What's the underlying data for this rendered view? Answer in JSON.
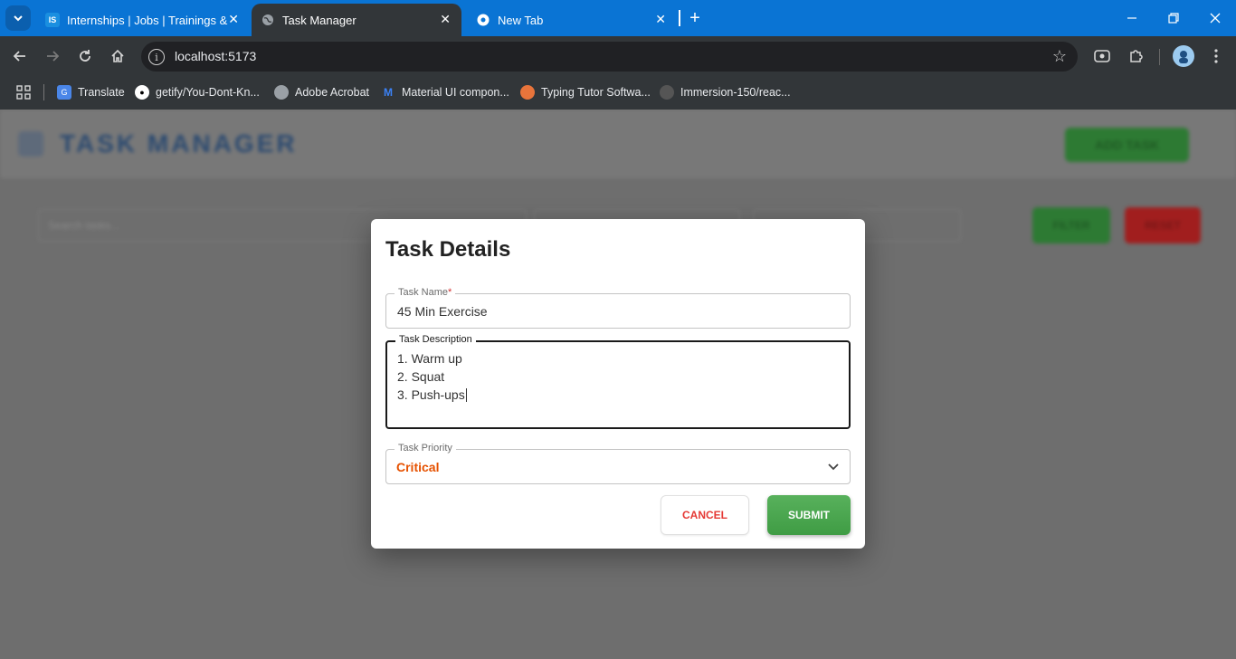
{
  "browser": {
    "tabs": [
      {
        "label": "Internships | Jobs | Trainings & I",
        "favicon": "IS",
        "active": false
      },
      {
        "label": "Task Manager",
        "favicon": "globe-icon",
        "active": true
      },
      {
        "label": "New Tab",
        "favicon": "chrome-icon",
        "active": false
      }
    ],
    "url": "localhost:5173",
    "bookmarks": [
      {
        "label": "Translate",
        "icon": "google-translate-icon"
      },
      {
        "label": "getify/You-Dont-Kn...",
        "icon": "github-icon"
      },
      {
        "label": "Adobe Acrobat",
        "icon": "globe-icon"
      },
      {
        "label": "Material UI compon...",
        "icon": "mui-icon"
      },
      {
        "label": "Typing Tutor Softwa...",
        "icon": "typing-tutor-icon"
      },
      {
        "label": "Immersion-150/reac...",
        "icon": "github-icon"
      }
    ]
  },
  "app": {
    "title": "TASK MANAGER",
    "add_task_label": "ADD TASK",
    "search_placeholder": "Search tasks...",
    "filter_label": "FILTER",
    "reset_label": "RESET"
  },
  "dialog": {
    "title": "Task Details",
    "name_label": "Task Name",
    "name_required_mark": "*",
    "name_value": "45 Min Exercise",
    "description_label": "Task Description",
    "description_lines": [
      "1. Warm up",
      "2. Squat",
      "3. Push-ups"
    ],
    "priority_label": "Task Priority",
    "priority_value": "Critical",
    "cancel_label": "CANCEL",
    "submit_label": "SUBMIT"
  },
  "colors": {
    "accent_blue": "#0a74d4",
    "priority_critical": "#e65100",
    "submit_green": "#43a047",
    "cancel_red": "#e53935"
  }
}
